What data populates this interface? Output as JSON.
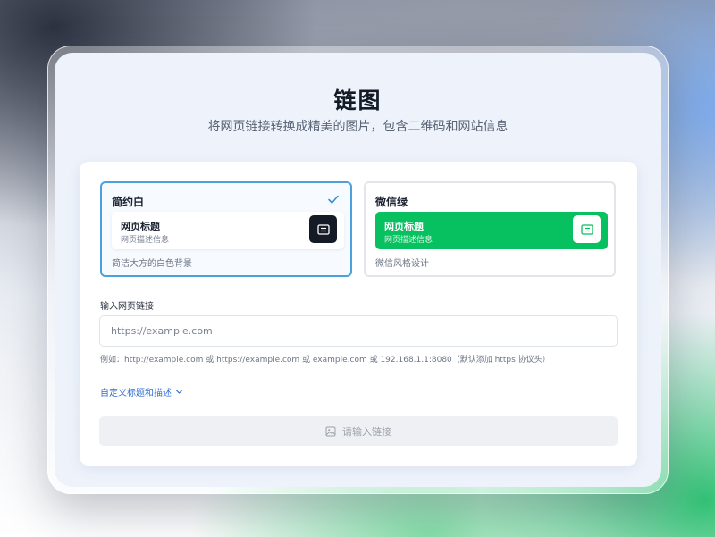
{
  "header": {
    "title": "链图",
    "subtitle": "将网页链接转换成精美的图片，包含二维码和网站信息"
  },
  "themes": [
    {
      "name": "简约白",
      "selected": true,
      "preview_title": "网页标题",
      "preview_desc": "网页描述信息",
      "description": "简洁大方的白色背景"
    },
    {
      "name": "微信绿",
      "selected": false,
      "preview_title": "网页标题",
      "preview_desc": "网页描述信息",
      "description": "微信风格设计"
    }
  ],
  "url_input": {
    "label": "输入网页链接",
    "value": "",
    "placeholder": "https://example.com",
    "hint": "例如：http://example.com 或 https://example.com 或 example.com 或 192.168.1.1:8080（默认添加 https 协议头）"
  },
  "custom_toggle": {
    "label": "自定义标题和描述",
    "icon": "chevron-down-icon"
  },
  "submit_button": {
    "label": "请输入链接",
    "icon": "image-icon",
    "disabled": true
  },
  "colors": {
    "selected_border": "#4aa1dc",
    "wechat_green": "#07c160",
    "link_blue": "#2f6fd0"
  }
}
